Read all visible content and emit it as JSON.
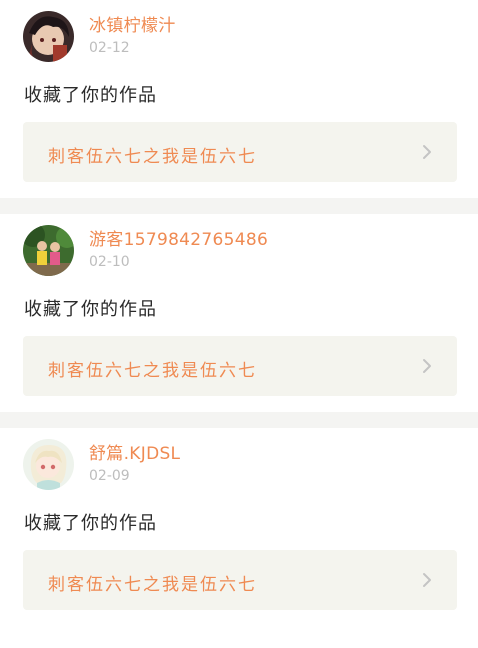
{
  "colors": {
    "accent": "#ef8a52",
    "date_gray": "#bdbdbd",
    "link_bg": "#f4f4ee",
    "divider_bg": "#f4f4f2",
    "text": "#2b2b2b"
  },
  "feed": {
    "items": [
      {
        "username": "冰镇柠檬汁",
        "date": "02-12",
        "action": "收藏了你的作品",
        "work_title": "刺客伍六七之我是伍六七",
        "avatar_icon": "anime-character-avatar",
        "chevron_icon": "chevron-right-icon"
      },
      {
        "username": "游客1579842765486",
        "date": "02-10",
        "action": "收藏了你的作品",
        "work_title": "刺客伍六七之我是伍六七",
        "avatar_icon": "photo-children-avatar",
        "chevron_icon": "chevron-right-icon"
      },
      {
        "username": "舒篇.KJDSL",
        "date": "02-09",
        "action": "收藏了你的作品",
        "work_title": "刺客伍六七之我是伍六七",
        "avatar_icon": "anime-girl-avatar",
        "chevron_icon": "chevron-right-icon"
      }
    ]
  }
}
